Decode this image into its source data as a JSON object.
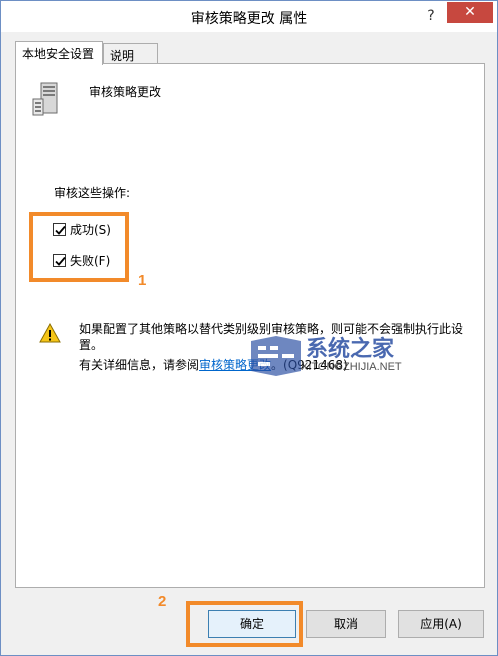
{
  "window": {
    "title": "审核策略更改 属性",
    "help_label": "?",
    "close_label": "✕"
  },
  "tabs": [
    {
      "label": "本地安全设置",
      "active": true
    },
    {
      "label": "说明",
      "active": false
    }
  ],
  "policy": {
    "name": "审核策略更改",
    "icon": "server-icon"
  },
  "audit": {
    "label": "审核这些操作:",
    "options": [
      {
        "label": "成功(S)",
        "checked": true
      },
      {
        "label": "失败(F)",
        "checked": true
      }
    ]
  },
  "warning": {
    "icon": "warning-icon",
    "text_line1": "如果配置了其他策略以替代类别级别审核策略，则可能不会强制执行此设置。",
    "text_prefix": "有关详细信息，请参阅",
    "link": "审核策略更改",
    "text_suffix": "。(Q921468)"
  },
  "watermark": {
    "text": "系统之家",
    "sub": "XITONGZHIJIA.NET"
  },
  "annotations": {
    "one": "1",
    "two": "2"
  },
  "buttons": {
    "ok": "确定",
    "cancel": "取消",
    "apply": "应用(A)"
  },
  "colors": {
    "accent_orange": "#f28a2a",
    "close_red": "#c7483f",
    "link_blue": "#0066cc"
  }
}
